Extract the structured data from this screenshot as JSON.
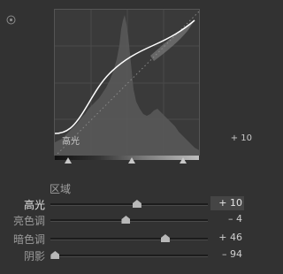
{
  "curve_panel": {
    "region_readout": {
      "name": "高光",
      "value": "+ 10"
    },
    "split_points": [
      0.1,
      0.5,
      0.86
    ]
  },
  "region_panel": {
    "title": "区域",
    "sliders": [
      {
        "label": "高光",
        "value_text": "+ 10",
        "value": 10,
        "active": true
      },
      {
        "label": "亮色调",
        "value_text": "– 4",
        "value": -4,
        "active": false
      },
      {
        "label": "暗色调",
        "value_text": "+ 46",
        "value": 46,
        "active": false
      },
      {
        "label": "阴影",
        "value_text": "– 94",
        "value": -94,
        "active": false
      }
    ]
  },
  "icons": {
    "target_adjust": "target-icon"
  },
  "colors": {
    "panel_bg": "#323232",
    "curve_line": "#ffffff",
    "histogram": "#5c5c5c",
    "thumb": "#b8b8b8"
  }
}
